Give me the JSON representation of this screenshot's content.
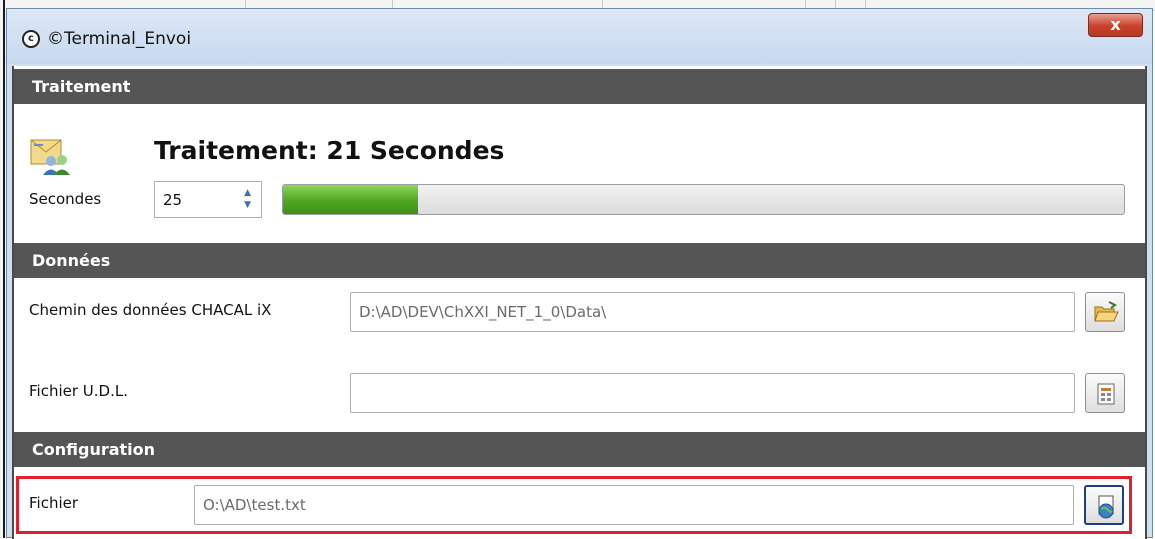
{
  "window": {
    "title": "©Terminal_Envoi",
    "close_label": "x"
  },
  "sections": {
    "traitement": {
      "header": "Traitement",
      "status": "Traitement: 21 Secondes",
      "seconds_label": "Secondes",
      "seconds_value": "25",
      "progress_fraction": 0.16
    },
    "donnees": {
      "header": "Données",
      "path_label": "Chemin des données CHACAL iX",
      "path_value": "D:\\AD\\DEV\\ChXXI_NET_1_0\\Data\\",
      "udl_label": "Fichier U.D.L.",
      "udl_value": ""
    },
    "configuration": {
      "header": "Configuration",
      "file_label": "Fichier",
      "file_value": "O:\\AD\\test.txt"
    }
  },
  "icons": {
    "app": "copyright-icon",
    "status": "contacts-envelope-icon",
    "spin_up": "chevron-up-icon",
    "spin_down": "chevron-down-icon",
    "path_browse": "open-folder-icon",
    "udl_browse": "data-table-icon",
    "file_browse": "globe-document-icon"
  },
  "colors": {
    "section_header": "#555555",
    "progress_fill": "#4ea721",
    "highlight": "#e02030",
    "close_button": "#c9402a"
  }
}
